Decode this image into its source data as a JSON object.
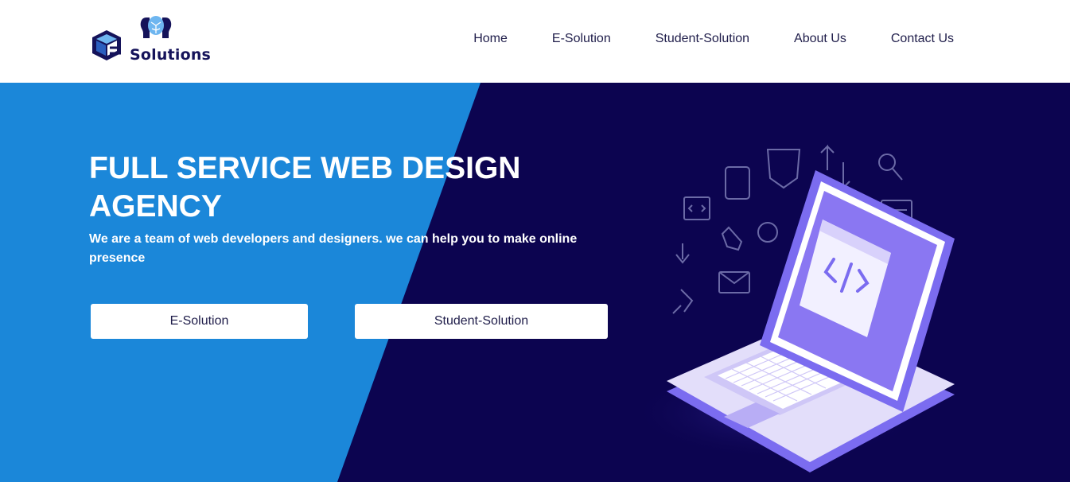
{
  "brand": {
    "name": "Solutions",
    "logo_icon": "e-cube-brain-logo",
    "colors": {
      "navy": "#15135a",
      "blue": "#2b5fbf",
      "light_blue": "#6eb6f0"
    }
  },
  "nav": {
    "items": [
      {
        "label": "Home"
      },
      {
        "label": "E-Solution"
      },
      {
        "label": "Student-Solution"
      },
      {
        "label": "About Us"
      },
      {
        "label": "Contact Us"
      }
    ]
  },
  "hero": {
    "headline": "FULL SERVICE WEB DESIGN AGENCY",
    "subheadline": "We are a team of web developers and designers. we can help you to make online presence",
    "buttons": [
      {
        "label": "E-Solution"
      },
      {
        "label": "Student-Solution"
      }
    ],
    "colors": {
      "left_panel": "#1b87d9",
      "right_panel": "#0c0450",
      "laptop_accent": "#7b6cf0"
    },
    "illustration": "laptop-code-illustration"
  }
}
